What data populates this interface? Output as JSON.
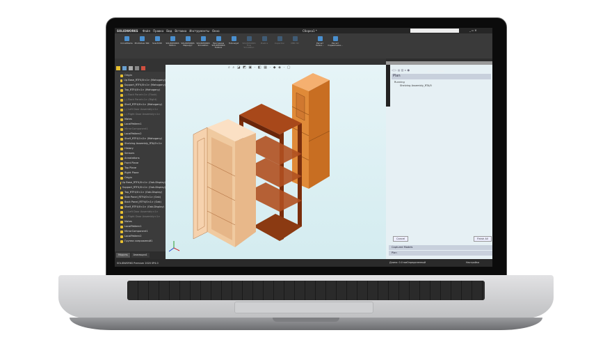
{
  "app": {
    "name": "SOLIDWORKS",
    "doc_title": "Сборка1 *",
    "search_placeholder": "Поиск в Справке по SOLIDWORKS"
  },
  "menu": [
    "Файл",
    "Правка",
    "Вид",
    "Вставка",
    "Инструменты",
    "Окно"
  ],
  "ribbon": [
    "CircuitWorks",
    "PhotoView 360",
    "ScanTo3D",
    "SOLIDWORKS Motion",
    "SOLIDWORKS Маршрут",
    "SOLIDWORKS Simulation",
    "Программа SOLIDWORKS Toolbox",
    "TolAnalyst",
    "SOLIDWORKS Flow Simulation",
    "Plastics",
    "Inspection",
    "MBD 3D",
    "Расчет балки...",
    "Расчет подшипника..."
  ],
  "tabs": [
    "Сборка",
    "Расположение",
    "Эскиз",
    "Анализировать",
    "Добавления SOLIDWORKS",
    "SOLIDWORKS Visualize"
  ],
  "active_tab": 4,
  "tree": [
    {
      "label": "Origin",
      "grey": false
    },
    {
      "label": "Up Base_RTF4/0<1> (Mahogany)",
      "grey": false
    },
    {
      "label": "Support_RTF4/0<1> (Mahogany)",
      "grey": false
    },
    {
      "label": "Top_RTF4/0<1> (Mahogany)",
      "grey": false
    },
    {
      "label": "(-) Back Panel<1> (Flush)",
      "grey": true
    },
    {
      "label": "(-) Back Panel<1> (Right)",
      "grey": true
    },
    {
      "label": "Shelf_RTF4/0<1> (Mahogany)",
      "grey": false
    },
    {
      "label": "(-) Left Door Assembly<1>",
      "grey": true
    },
    {
      "label": "(-) Right Door Assembly<1>",
      "grey": true
    },
    {
      "label": "Mates",
      "grey": false
    },
    {
      "label": "LocalPattern1",
      "grey": false
    },
    {
      "label": "MirrorComponent1",
      "grey": true
    },
    {
      "label": "LocalPattern2",
      "grey": false
    },
    {
      "label": "Shelf_RTF4/1<2> (Mahogany)",
      "grey": false
    },
    {
      "label": "Shelving Assembly_RTA/0<1>",
      "grey": false
    },
    {
      "label": "History",
      "grey": false
    },
    {
      "label": "Sensors",
      "grey": false
    },
    {
      "label": "Annotations",
      "grey": false
    },
    {
      "label": "Front Plane",
      "grey": false
    },
    {
      "label": "Top Plane",
      "grey": false
    },
    {
      "label": "Right Plane",
      "grey": false
    },
    {
      "label": "Origin",
      "grey": false
    },
    {
      "label": "Up Base_RTF4/0<1> (Oak-Display)",
      "grey": false
    },
    {
      "label": "Support_RTF4/0<1> (Oak-Display)",
      "grey": false
    },
    {
      "label": "Top_RTF4/0<1> (Oak-Display)",
      "grey": false
    },
    {
      "label": "Side Panel_RTF4/0<1> (Oak)",
      "grey": false
    },
    {
      "label": "Back Panel_RTF4/0<1> (Oak)",
      "grey": false
    },
    {
      "label": "Shelf_RTF4/0<1> (Oak-Display)",
      "grey": false
    },
    {
      "label": "(-) Left Door Assembly<1>",
      "grey": true
    },
    {
      "label": "(-) Right Door Assembly<1>",
      "grey": true
    },
    {
      "label": "Mates",
      "grey": false
    },
    {
      "label": "LocalPattern1",
      "grey": false
    },
    {
      "label": "MirrorComponent1",
      "grey": false
    },
    {
      "label": "LocalPattern2",
      "grey": false
    },
    {
      "label": "Группа сопряжений1",
      "grey": false
    }
  ],
  "bottom_tabs": [
    "Модель",
    "Анимация1"
  ],
  "status_left": "SOLIDWORKS Premium 2020 SP4.0",
  "status_right": [
    "Длина: 0.0 мм",
    "Определенный",
    "Настройка"
  ],
  "task_pane": {
    "title": "SolidWorks Task",
    "section": "Plan",
    "tree_root": "Running",
    "tree_child": "Shelving Assembly_RTA/0",
    "cancel": "Cancel",
    "finish": "Finish All",
    "panels": [
      "Captured Models",
      "Plan"
    ]
  },
  "colors": {
    "viewport": "#d9eef2",
    "cabinet_light": "#f2c9a0",
    "cabinet_dark": "#8b3a12",
    "cabinet_orange": "#e08a38"
  }
}
